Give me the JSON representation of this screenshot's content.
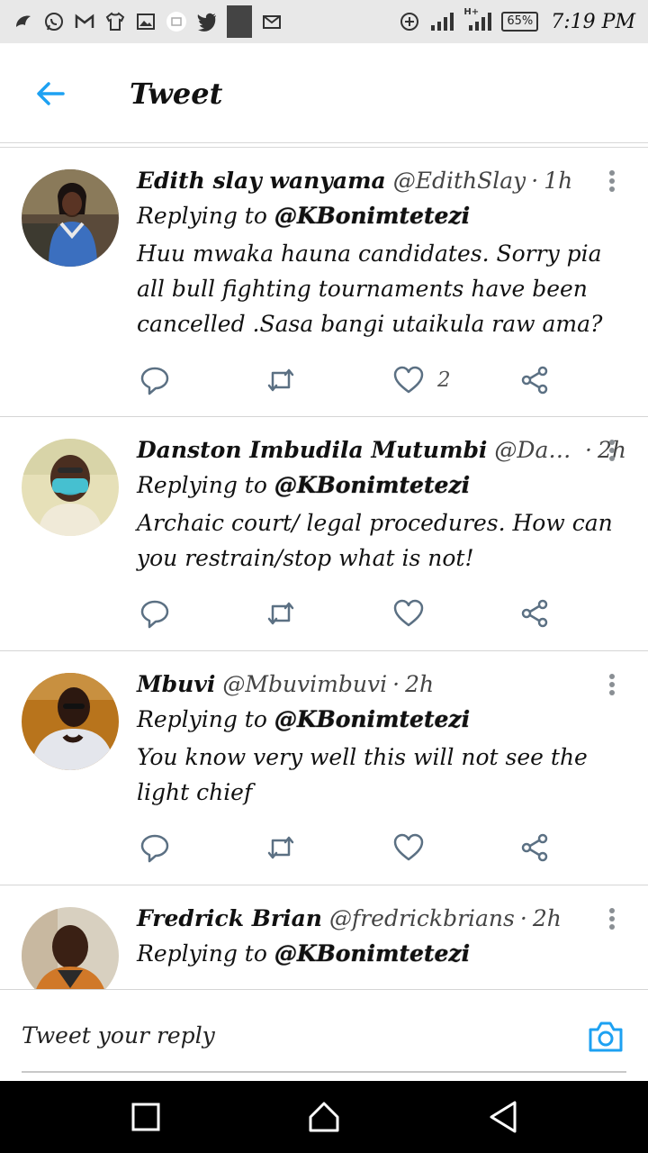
{
  "status_bar": {
    "battery": "65%",
    "time": "7:19 PM",
    "icons": [
      "app-icon",
      "whatsapp-icon",
      "gmail-icon",
      "shirt-icon",
      "image-icon",
      "message-icon",
      "twitter-icon",
      "square-icon",
      "mail-icon",
      "add-circle-icon",
      "signal-icon",
      "signal-h-icon"
    ],
    "network_label": "H+"
  },
  "header": {
    "title": "Tweet",
    "accent_color": "#1da1f2"
  },
  "tweets": [
    {
      "name": "Edith slay wanyama",
      "handle": "@EdithSlay",
      "time": "1h",
      "replying_prefix": "Replying to",
      "replying_handle": "@KBonimtetezi",
      "text": "Huu mwaka hauna  candidates. Sorry pia  all bull fighting tournaments have been cancelled .Sasa bangi utaikula raw ama?",
      "like_count": "2"
    },
    {
      "name": "Danston Imbudila Mutumbi",
      "handle": "@Danst...",
      "time": "2h",
      "replying_prefix": "Replying to",
      "replying_handle": "@KBonimtetezi",
      "text": "Archaic court/ legal procedures. How can you restrain/stop what is not!",
      "like_count": ""
    },
    {
      "name": "Mbuvi",
      "handle": "@Mbuvimbuvi",
      "time": "2h",
      "replying_prefix": "Replying to",
      "replying_handle": "@KBonimtetezi",
      "text": "You know very well this will not see the light chief",
      "like_count": ""
    },
    {
      "name": "Fredrick Brian",
      "handle": "@fredrickbrians",
      "time": "2h",
      "replying_prefix": "Replying to",
      "replying_handle": "@KBonimtetezi",
      "text": "",
      "like_count": ""
    }
  ],
  "reply_bar": {
    "placeholder": "Tweet your reply"
  },
  "nav": {
    "icons": [
      "recents-icon",
      "home-icon",
      "back-triangle-icon"
    ]
  }
}
